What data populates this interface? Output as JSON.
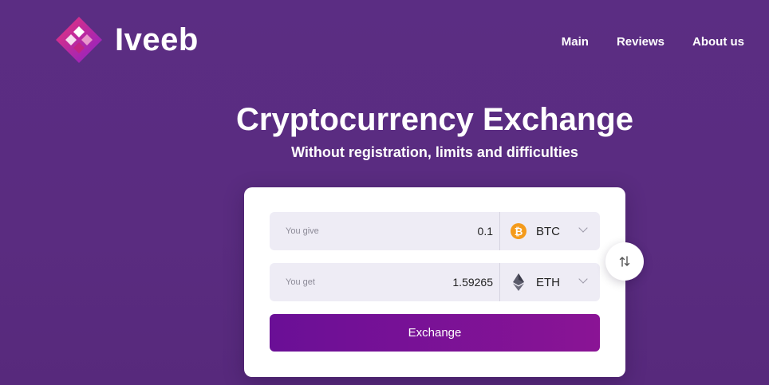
{
  "brand": {
    "name": "Iveeb",
    "colors": {
      "accent": "#7b1194",
      "background": "#5a2c80",
      "btc": "#f49b1c"
    }
  },
  "nav": {
    "items": [
      {
        "label": "Main"
      },
      {
        "label": "Reviews"
      },
      {
        "label": "About us"
      }
    ]
  },
  "hero": {
    "title": "Cryptocurrency Exchange",
    "subtitle": "Without registration, limits and difficulties"
  },
  "exchange": {
    "give": {
      "label": "You give",
      "value": "0.1",
      "currency": "BTC",
      "icon": "bitcoin-icon"
    },
    "get": {
      "label": "You get",
      "value": "1.59265",
      "currency": "ETH",
      "icon": "ethereum-icon"
    },
    "swap_icon": "swap-arrows-icon",
    "button_label": "Exchange"
  }
}
